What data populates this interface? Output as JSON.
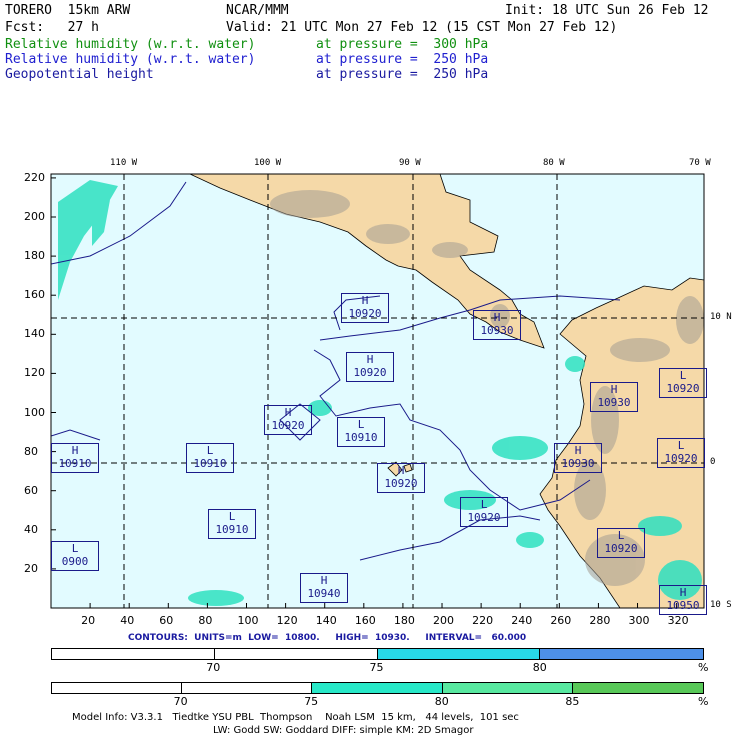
{
  "header": {
    "model": "TORERO  15km ARW",
    "center": "NCAR/MMM",
    "init": "Init: 18 UTC Sun 26 Feb 12",
    "fcst": "Fcst:   27 h",
    "valid": "Valid: 21 UTC Mon 27 Feb 12 (15 CST Mon 27 Feb 12)"
  },
  "fields": [
    {
      "name": "Relative humidity (w.r.t. water)",
      "level": "at pressure =  300 hPa",
      "color": "#109010"
    },
    {
      "name": "Relative humidity (w.r.t. water)",
      "level": "at pressure =  250 hPa",
      "color": "#2020d0"
    },
    {
      "name": "Geopotential height",
      "level": "at pressure =  250 hPa",
      "color": "#1a1aa0"
    }
  ],
  "map": {
    "lon_labels": [
      "110 W",
      "100 W",
      "90 W",
      "80 W",
      "70 W"
    ],
    "lat_labels": [
      "10 N",
      "0",
      "10 S"
    ],
    "x_ticks": [
      "20",
      "40",
      "60",
      "80",
      "100",
      "120",
      "140",
      "160",
      "180",
      "200",
      "220",
      "240",
      "260",
      "280",
      "300",
      "320"
    ],
    "y_ticks": [
      "220",
      "200",
      "180",
      "160",
      "140",
      "120",
      "100",
      "80",
      "60",
      "40",
      "20"
    ],
    "colors": {
      "ocean": "#e2fbff",
      "land": "#f5d9a8",
      "moist": "#2ee0c0",
      "contour": "#1a1a8a",
      "label": "#1a1a8a"
    },
    "centers": [
      {
        "type": "H",
        "value": "10920"
      },
      {
        "type": "H",
        "value": "10930"
      },
      {
        "type": "H",
        "value": "10920"
      },
      {
        "type": "H",
        "value": "10920"
      },
      {
        "type": "L",
        "value": "10910"
      },
      {
        "type": "H",
        "value": "10910"
      },
      {
        "type": "L",
        "value": "10910"
      },
      {
        "type": "H",
        "value": "10920"
      },
      {
        "type": "H",
        "value": "10930"
      },
      {
        "type": "H",
        "value": "10930"
      },
      {
        "type": "L",
        "value": "10920"
      },
      {
        "type": "L",
        "value": "10920"
      },
      {
        "type": "L",
        "value": "10920"
      },
      {
        "type": "L",
        "value": "10910"
      },
      {
        "type": "L",
        "value": "0900"
      },
      {
        "type": "L",
        "value": "10920"
      },
      {
        "type": "H",
        "value": "10940"
      },
      {
        "type": "H",
        "value": "10950"
      }
    ]
  },
  "contours_info": "CONTOURS:  UNITS=m  LOW=  10800.     HIGH=  10930.     INTERVAL=   60.000",
  "colorbar_250": {
    "ticks": [
      "70",
      "75",
      "80"
    ],
    "unit": "%",
    "colors": [
      "#ffffff",
      "#ffffff",
      "#28d8e8",
      "#4d90e8"
    ]
  },
  "colorbar_300": {
    "ticks": [
      "70",
      "75",
      "80",
      "85"
    ],
    "unit": "%",
    "colors": [
      "#ffffff",
      "#ffffff",
      "#28e8c8",
      "#58e8a0",
      "#58c858"
    ]
  },
  "footer": {
    "line1": "Model Info: V3.3.1   Tiedtke YSU PBL  Thompson    Noah LSM  15 km,   44 levels,  101 sec",
    "line2": "LW: Godd SW: Goddard DIFF: simple KM: 2D Smagor"
  }
}
